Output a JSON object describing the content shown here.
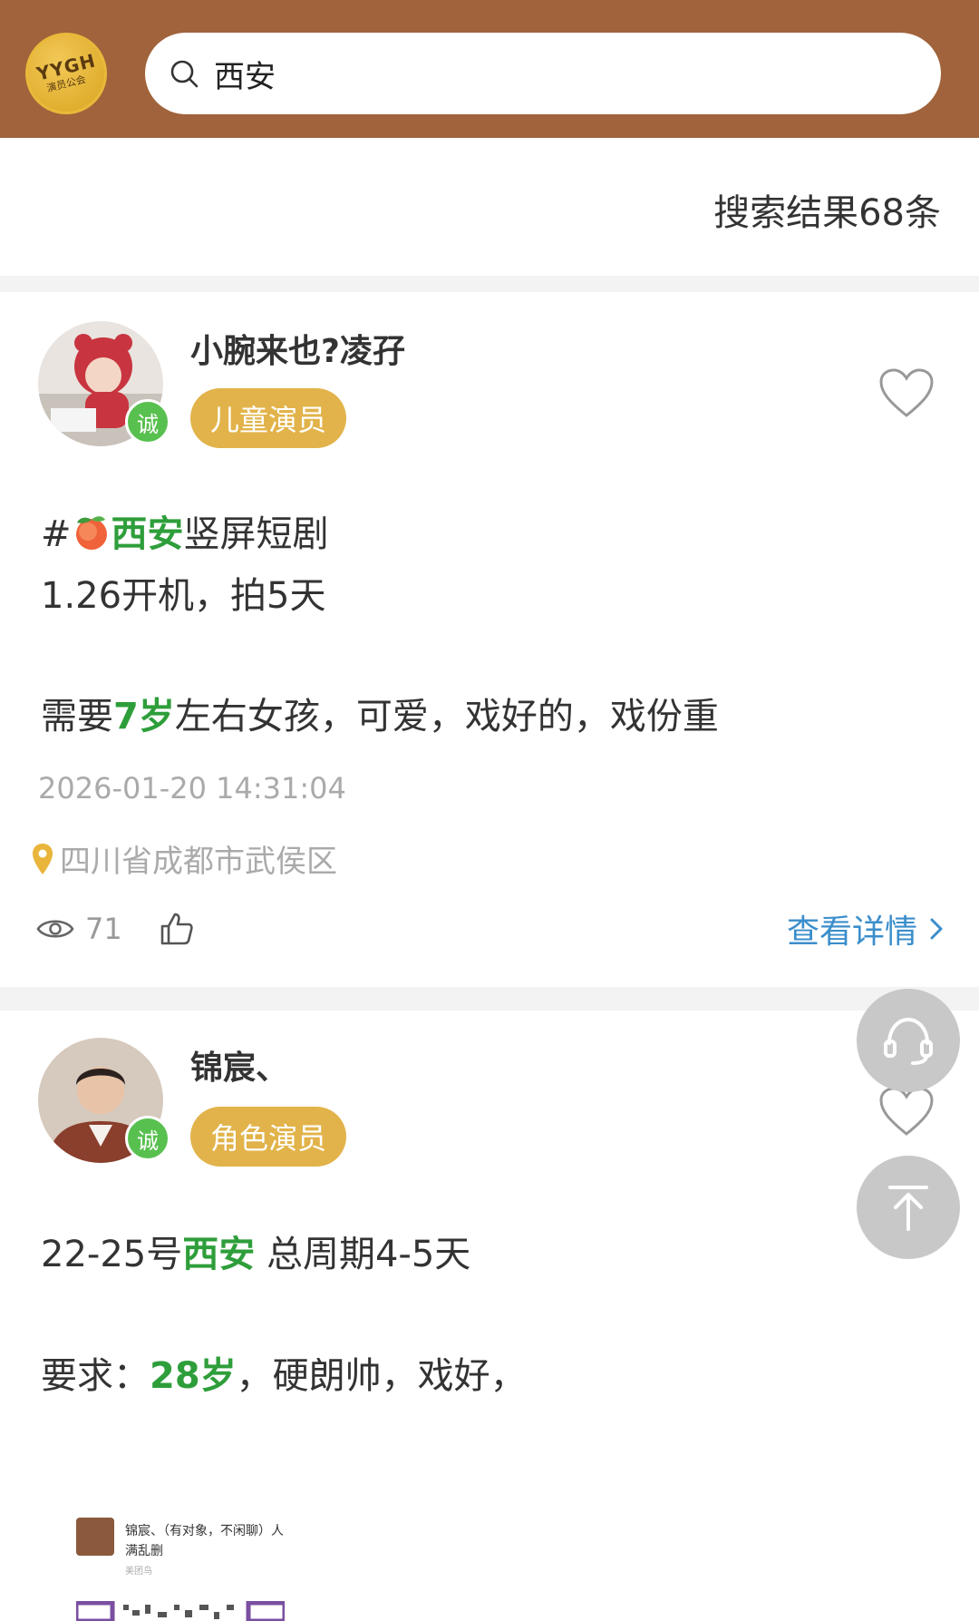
{
  "header": {
    "logo_text": "YYGH",
    "logo_sub": "演员公会",
    "search_value": "西安"
  },
  "results": {
    "count_label": "搜索结果68条"
  },
  "posts": [
    {
      "username": "小腕来也?凌孖",
      "verified_badge": "诚",
      "role_tag": "儿童演员",
      "line1_prefix": "#",
      "line1_highlight": "西安",
      "line1_suffix": "竖屏短剧",
      "line2": "1.26开机，拍5天",
      "line3_prefix": "需要",
      "line3_highlight": "7岁",
      "line3_suffix": "左右女孩，可爱，戏好的，戏份重",
      "timestamp": "2026-01-20 14:31:04",
      "location": "四川省成都市武侯区",
      "views": "71",
      "detail_link": "查看详情"
    },
    {
      "username": "锦宸、",
      "verified_badge": "诚",
      "role_tag": "角色演员",
      "line1_prefix": "22-25号",
      "line1_highlight": "西安",
      "line1_suffix": " 总周期4-5天",
      "line2_prefix": "要求：",
      "line2_highlight": "28岁",
      "line2_suffix": "，硬朗帅，戏好，"
    }
  ],
  "preview": {
    "name": "锦宸、（有对象，不闲聊）人满乱删",
    "sub": "美团鸟"
  },
  "colors": {
    "header_bg": "#a0633b",
    "tag_bg": "#e2b34a",
    "highlight": "#2e9e3a",
    "link": "#3b8ecb"
  }
}
